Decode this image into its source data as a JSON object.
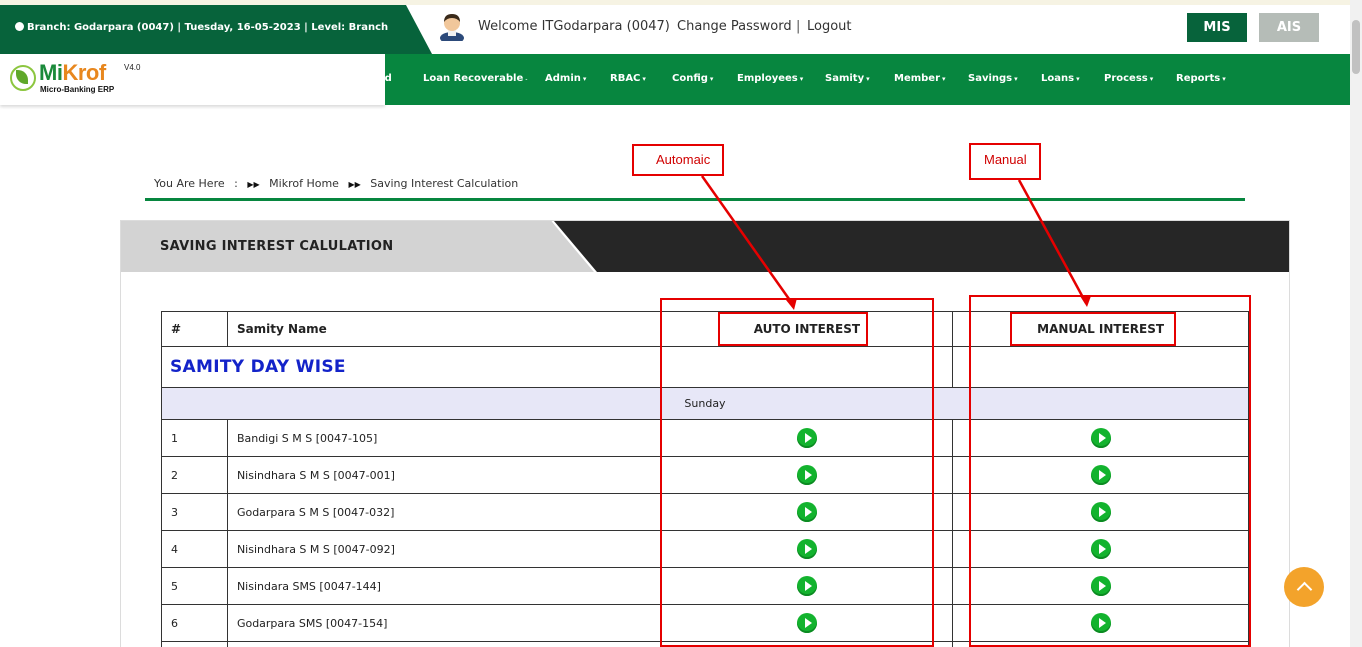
{
  "header": {
    "branch_info": "Branch: Godarpara (0047) | Tuesday, 16-05-2023 | Level: Branch",
    "welcome": "Welcome ITGodarpara (0047)",
    "change_password": "Change Password",
    "separator": "|",
    "logout": "Logout",
    "mis_button": "MIS",
    "ais_button": "AIS"
  },
  "logo": {
    "name_mi": "Mi",
    "name_rest": "Krof",
    "version": "V4.0",
    "tagline": "Micro-Banking ERP"
  },
  "nav": {
    "items": [
      {
        "label": "ard",
        "caret": ""
      },
      {
        "label": "Loan Recoverable",
        "caret": "˗"
      },
      {
        "label": "Admin",
        "caret": "▾"
      },
      {
        "label": "RBAC",
        "caret": "▾"
      },
      {
        "label": "Config",
        "caret": "▾"
      },
      {
        "label": "Employees",
        "caret": "▾"
      },
      {
        "label": "Samity",
        "caret": "▾"
      },
      {
        "label": "Member",
        "caret": "▾"
      },
      {
        "label": "Savings",
        "caret": "▾"
      },
      {
        "label": "Loans",
        "caret": "▾"
      },
      {
        "label": "Process",
        "caret": "▾"
      },
      {
        "label": "Reports",
        "caret": "▾"
      }
    ]
  },
  "breadcrumb": {
    "prefix": "You Are Here",
    "colon": ":",
    "home": "Mikrof Home",
    "current": "Saving Interest Calculation"
  },
  "panel": {
    "title": "SAVING INTEREST CALULATION"
  },
  "table": {
    "headers": {
      "num": "#",
      "name": "Samity Name",
      "auto": "AUTO INTEREST",
      "manual": "MANUAL INTEREST"
    },
    "section_title": "SAMITY DAY WISE",
    "day": "Sunday",
    "rows": [
      {
        "num": "1",
        "name": "Bandigi S M S [0047-105]"
      },
      {
        "num": "2",
        "name": "Nisindhara S M S [0047-001]"
      },
      {
        "num": "3",
        "name": "Godarpara S M S [0047-032]"
      },
      {
        "num": "4",
        "name": "Nisindhara S M S [0047-092]"
      },
      {
        "num": "5",
        "name": "Nisindara SMS [0047-144]"
      },
      {
        "num": "6",
        "name": "Godarpara SMS [0047-154]"
      }
    ]
  },
  "annotations": {
    "automatic_label": "Automaic",
    "manual_label": "Manual"
  },
  "icons": {
    "user": "user-avatar-icon",
    "globe": "globe-icon",
    "play": "play-icon",
    "breadcrumb_arrow": "double-chevron-right-icon",
    "back_to_top": "chevron-up-icon"
  },
  "colors": {
    "dark_green": "#07633b",
    "nav_green": "#07863f",
    "play_green": "#13b32e",
    "annotation_red": "#e50000",
    "section_blue": "#1323c9",
    "back_to_top": "#f3a32b"
  }
}
